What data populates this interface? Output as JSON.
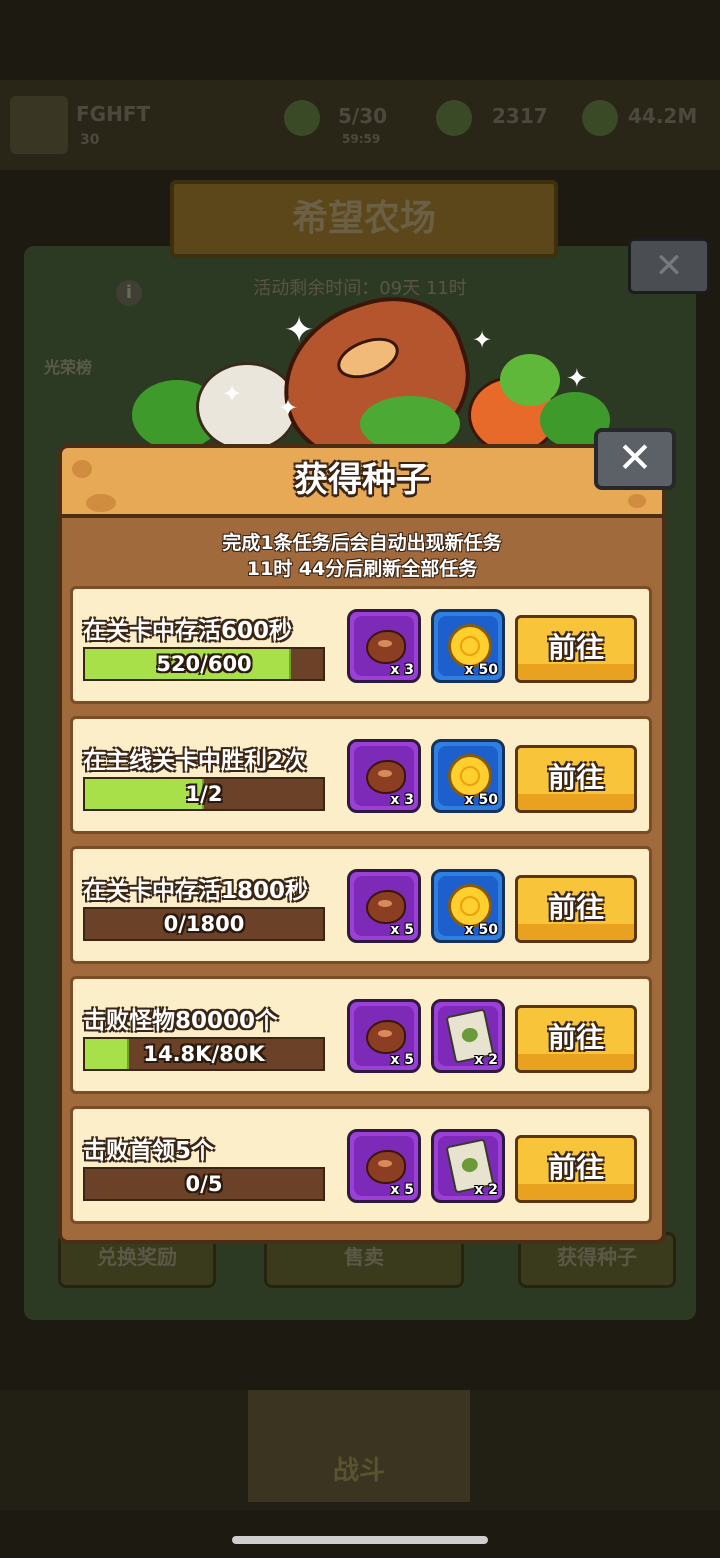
{
  "background": {
    "username": "FGHFT",
    "level": "30",
    "energy": "5/30",
    "timer_small": "59:59",
    "gems": "2317",
    "coins": "44.2M",
    "event_title": "希望农场",
    "event_time": "活动剩余时间：09天 11时",
    "honor_label": "光荣榜",
    "bottom_buttons": {
      "exchange": "兑换奖励",
      "sell": "售卖",
      "get_seeds": "获得种子"
    },
    "battle_label": "战斗"
  },
  "dialog": {
    "title": "获得种子",
    "info_line1": "完成1条任务后会自动出现新任务",
    "info_line2": "11时 44分后刷新全部任务",
    "close_symbol": "✕"
  },
  "tasks": [
    {
      "title": "在关卡中存活600秒",
      "progress_text": "520/600",
      "progress": 0.867,
      "rewards": [
        {
          "icon": "bean-icon",
          "qty": "x 3"
        },
        {
          "icon": "coin-icon",
          "qty": "x 50"
        }
      ],
      "button": "前往"
    },
    {
      "title": "在主线关卡中胜利2次",
      "progress_text": "1/2",
      "progress": 0.5,
      "rewards": [
        {
          "icon": "bean-icon",
          "qty": "x 3"
        },
        {
          "icon": "coin-icon",
          "qty": "x 50"
        }
      ],
      "button": "前往"
    },
    {
      "title": "在关卡中存活1800秒",
      "progress_text": "0/1800",
      "progress": 0,
      "rewards": [
        {
          "icon": "bean-icon",
          "qty": "x 5"
        },
        {
          "icon": "coin-icon",
          "qty": "x 50"
        }
      ],
      "button": "前往"
    },
    {
      "title": "击败怪物80000个",
      "progress_text": "14.8K/80K",
      "progress": 0.185,
      "rewards": [
        {
          "icon": "bean-icon",
          "qty": "x 5"
        },
        {
          "icon": "seed-pack-icon",
          "qty": "x 2"
        }
      ],
      "button": "前往"
    },
    {
      "title": "击败首领5个",
      "progress_text": "0/5",
      "progress": 0,
      "rewards": [
        {
          "icon": "bean-icon",
          "qty": "x 5"
        },
        {
          "icon": "seed-pack-icon",
          "qty": "x 2"
        }
      ],
      "button": "前往"
    }
  ]
}
